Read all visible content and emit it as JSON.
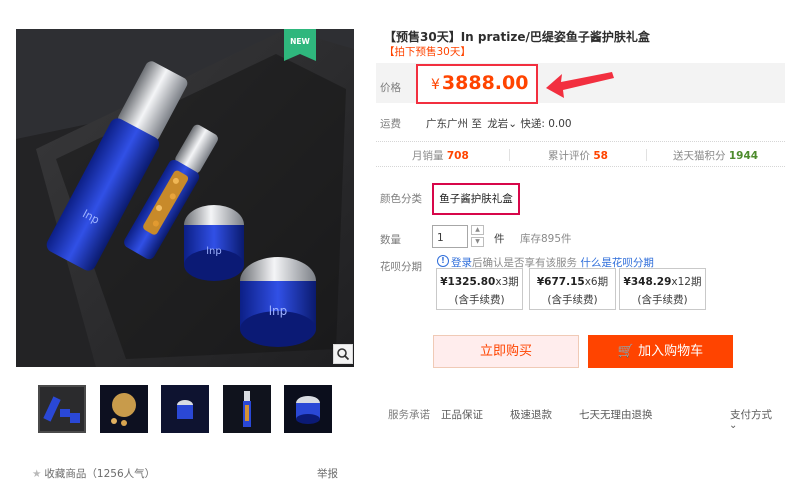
{
  "gallery": {
    "new_badge": "NEW",
    "thumbnail_count": 5,
    "selected_thumbnail": 1
  },
  "product": {
    "title": "【预售30天】In pratize/巴缇姿鱼子酱护肤礼盒",
    "subtitle": "【拍下预售30天】"
  },
  "price": {
    "label": "价格",
    "currency": "¥",
    "value": "3888.00",
    "color": "#ff4400"
  },
  "shipping": {
    "label": "运费",
    "origin": "广东广州",
    "to": "至",
    "destination": "龙岩",
    "method": "快递: 0.00"
  },
  "stats": {
    "monthly_sales_label": "月销量",
    "monthly_sales": "708",
    "reviews_label": "累计评价",
    "reviews": "58",
    "points_label": "送天猫积分",
    "points": "1944"
  },
  "options": {
    "color_label": "颜色分类",
    "color_value": "鱼子酱护肤礼盒",
    "qty_label": "数量",
    "qty_value": "1",
    "qty_unit": "件",
    "stock": "库存895件"
  },
  "huabei": {
    "label": "花呗分期",
    "note_login": "登录",
    "note_text": "后确认是否享有该服务",
    "note_link": "什么是花呗分期",
    "plans": [
      {
        "amount": "¥1325.80",
        "periods": "x3期",
        "fee": "(含手续费)"
      },
      {
        "amount": "¥677.15",
        "periods": "x6期",
        "fee": "(含手续费)"
      },
      {
        "amount": "¥348.29",
        "periods": "x12期",
        "fee": "(含手续费)"
      }
    ]
  },
  "actions": {
    "buy_now": "立即购买",
    "add_to_cart": "加入购物车"
  },
  "service": {
    "label": "服务承诺",
    "items": [
      "正品保证",
      "极速退款",
      "七天无理由退换"
    ],
    "payment_label": "支付方式"
  },
  "footer": {
    "favorite": "收藏商品",
    "popularity": "（1256人气）",
    "report": "举报"
  },
  "colors": {
    "accent": "#ff4400",
    "highlight_border": "#f22f3f",
    "link": "#2f6eda"
  }
}
